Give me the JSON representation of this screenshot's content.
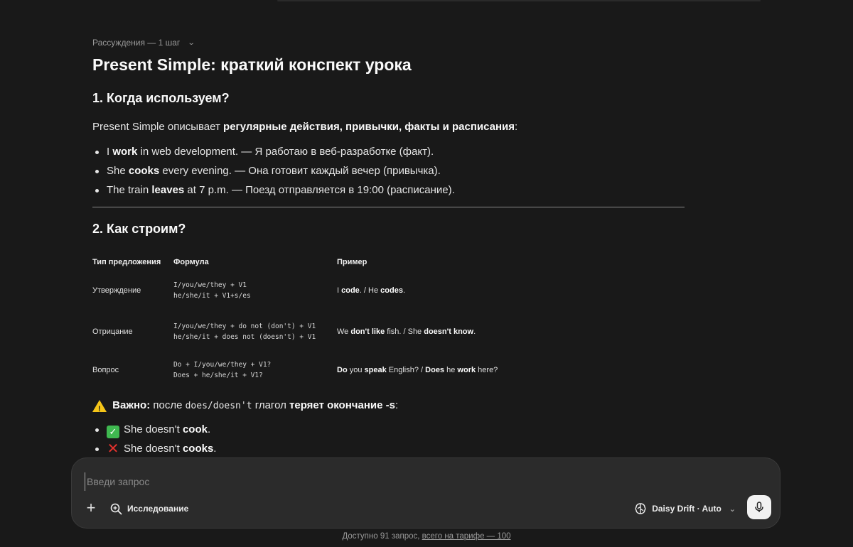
{
  "reasoning": {
    "label": "Рассуждения — 1 шаг"
  },
  "article": {
    "title": "Present Simple: краткий конспект урока",
    "section1": {
      "heading": "1. Когда используем?",
      "lead_pre": "Present Simple описывает ",
      "lead_bold": "регулярные действия, привычки, факты и расписания",
      "lead_post": ":",
      "bullets": [
        {
          "a": "I ",
          "b": "work",
          "c": " in web development. — Я работаю в веб-разработке (факт)."
        },
        {
          "a": "She ",
          "b": "cooks",
          "c": " every evening. — Она готовит каждый вечер (привычка)."
        },
        {
          "a": "The train ",
          "b": "leaves",
          "c": " at 7 p.m. — Поезд отправляется в 19:00 (расписание)."
        }
      ]
    },
    "section2": {
      "heading": "2. Как строим?",
      "table": {
        "headers": [
          "Тип предложения",
          "Формула",
          "Пример"
        ],
        "rows": [
          {
            "type": "Утверждение",
            "f1": "I/you/we/they + V1",
            "f2": "he/she/it + V1+s/es",
            "ex": [
              {
                "t": "I ",
                "b": false
              },
              {
                "t": "code",
                "b": true
              },
              {
                "t": ". / He ",
                "b": false
              },
              {
                "t": "codes",
                "b": true
              },
              {
                "t": ".",
                "b": false
              }
            ]
          },
          {
            "type": "Отрицание",
            "f1": "I/you/we/they + do not (don't) + V1",
            "f2": "he/she/it + does not (doesn't) + V1",
            "ex": [
              {
                "t": "We ",
                "b": false
              },
              {
                "t": "don't like",
                "b": true
              },
              {
                "t": " fish. / She ",
                "b": false
              },
              {
                "t": "doesn't know",
                "b": true
              },
              {
                "t": ".",
                "b": false
              }
            ]
          },
          {
            "type": "Вопрос",
            "f1": "Do + I/you/we/they + V1?",
            "f2": "Does + he/she/it + V1?",
            "ex": [
              {
                "t": "Do",
                "b": true
              },
              {
                "t": " you ",
                "b": false
              },
              {
                "t": "speak",
                "b": true
              },
              {
                "t": " English? / ",
                "b": false
              },
              {
                "t": "Does",
                "b": true
              },
              {
                "t": " he ",
                "b": false
              },
              {
                "t": "work",
                "b": true
              },
              {
                "t": " here?",
                "b": false
              }
            ]
          }
        ]
      },
      "warning": {
        "bold1": "Важно:",
        "t1": " после ",
        "code": "does/doesn't",
        "t2": " глагол ",
        "bold2": "теряет окончание -s",
        "t3": ":"
      },
      "examples": [
        {
          "icon": "check-icon",
          "a": "She doesn't ",
          "b": "cook",
          "c": "."
        },
        {
          "icon": "cross-icon",
          "a": "She doesn't ",
          "b": "cooks",
          "c": "."
        }
      ]
    }
  },
  "composer": {
    "placeholder": "Введи запрос",
    "research_label": "Исследование",
    "model_label": "Daisy Drift · Auto"
  },
  "footer": {
    "text": "Доступно 91 запрос, ",
    "link": "всего на тарифе — 100"
  },
  "icons": [
    "chevron-down-icon",
    "plus-icon",
    "search-plus-icon",
    "brain-icon",
    "mic-icon",
    "warning-icon",
    "check-icon",
    "cross-icon"
  ]
}
